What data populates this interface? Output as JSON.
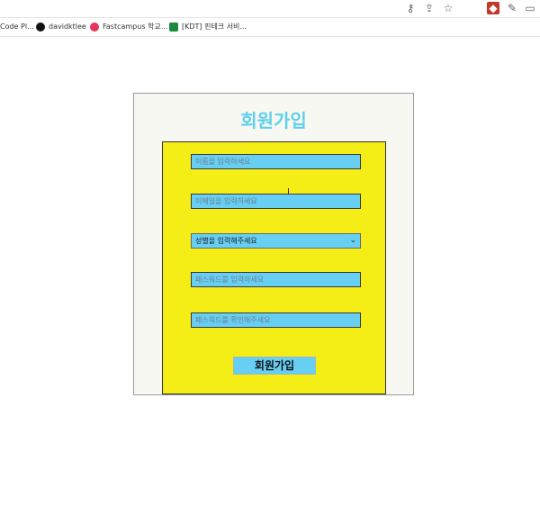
{
  "browser": {
    "bookmarks": [
      {
        "label": "Code Pl...",
        "color": "#555555"
      },
      {
        "label": "davidktlee",
        "color": "#111111"
      },
      {
        "label": "Fastcampus 학교...",
        "color": "#e8345c"
      },
      {
        "label": "[KDT] 핀테크 서비...",
        "color": "#1d8a3f"
      }
    ],
    "icons": [
      "key-icon",
      "share-icon",
      "star-icon",
      "extension-icon",
      "eyedropper-icon",
      "window-icon"
    ]
  },
  "page": {
    "title": "회원가입",
    "fields": {
      "name_placeholder": "이름을 입력하세요",
      "email_placeholder": "이메일을 입력하세요",
      "gender_selected": "성별을 입력해주세요",
      "password_placeholder": "패스워드를 입력하세요",
      "password_confirm_placeholder": "패스워드를 확인해주세요"
    },
    "submit_label": "회원가입",
    "colors": {
      "title": "#5fcfee",
      "form_background": "#f4ed16",
      "field_background": "#67cff3",
      "panel_background": "#f8f8f2"
    }
  }
}
